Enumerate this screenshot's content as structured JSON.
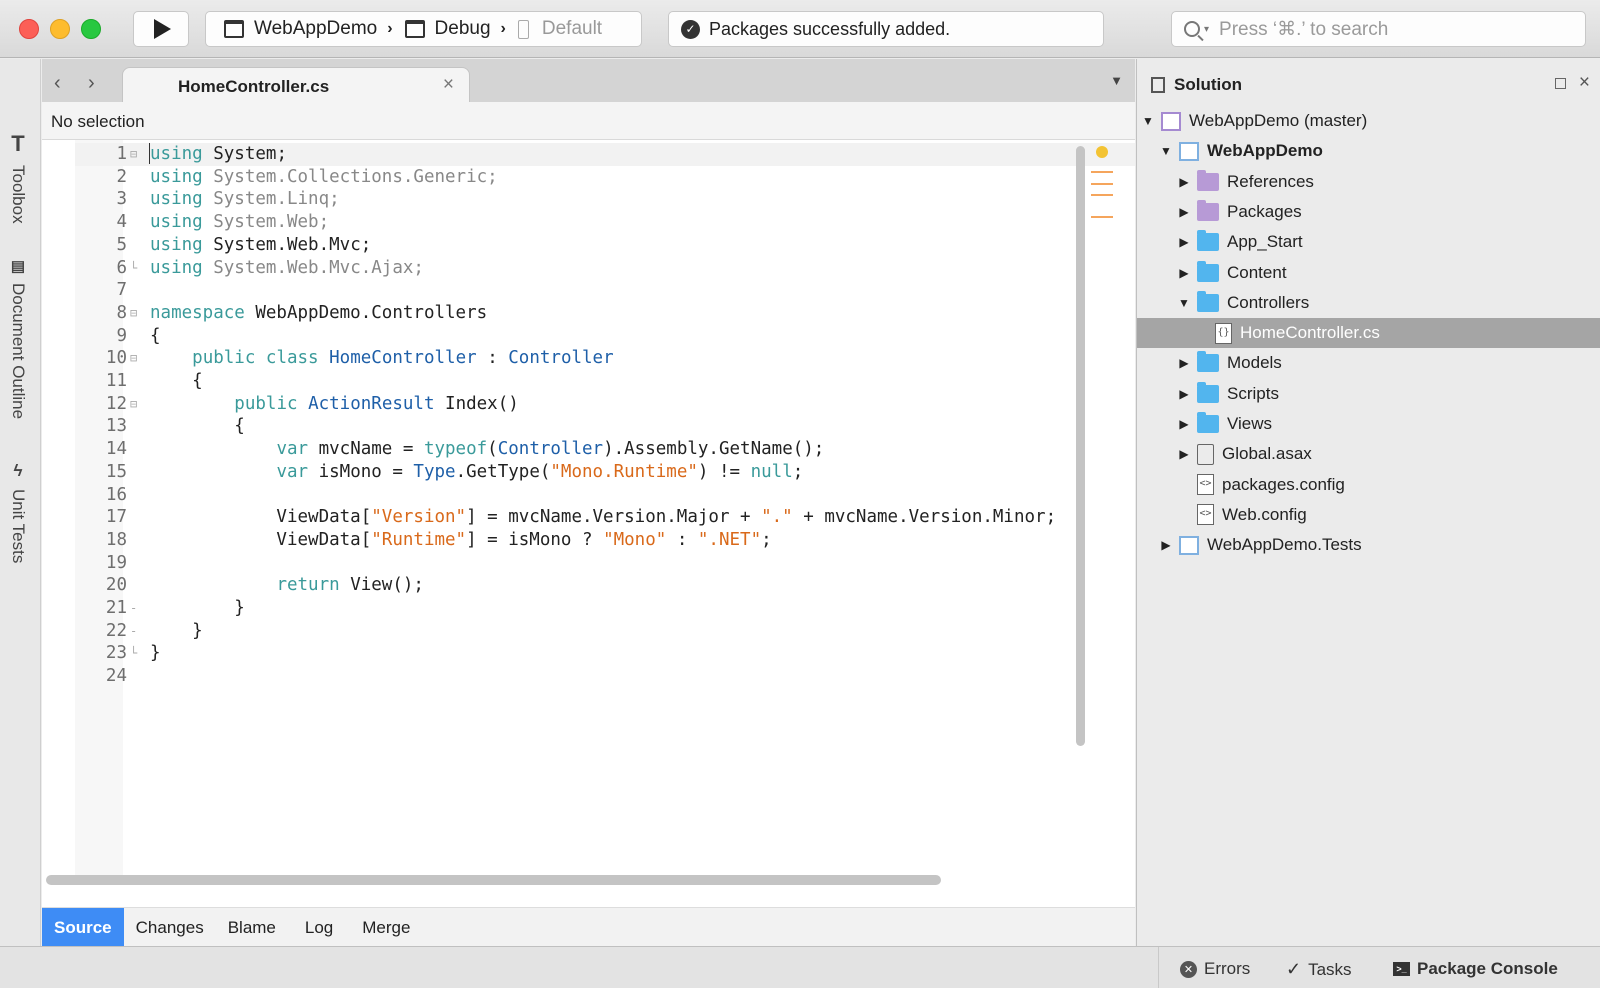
{
  "toolbar": {
    "project": "WebAppDemo",
    "configuration": "Debug",
    "device": "Default",
    "status_message": "Packages successfully added.",
    "search_placeholder": "Press ‘⌘.’ to search"
  },
  "side_pads": [
    "Toolbox",
    "Document Outline",
    "Unit Tests"
  ],
  "editor": {
    "tab_title": "HomeController.cs",
    "breadcrumb": "No selection",
    "lines": [
      {
        "n": "1",
        "fold": "⊟",
        "html": "<span class=\"kw\">using</span> System;"
      },
      {
        "n": "2",
        "fold": "",
        "html": "<span class=\"kw\">using</span> <span class=\"dim\">System.Collections.Generic;</span>"
      },
      {
        "n": "3",
        "fold": "",
        "html": "<span class=\"kw\">using</span> <span class=\"dim\">System.Linq;</span>"
      },
      {
        "n": "4",
        "fold": "",
        "html": "<span class=\"kw\">using</span> <span class=\"dim\">System.Web;</span>"
      },
      {
        "n": "5",
        "fold": "",
        "html": "<span class=\"kw\">using</span> System.Web.Mvc;"
      },
      {
        "n": "6",
        "fold": "└",
        "html": "<span class=\"kw\">using</span> <span class=\"dim\">System.Web.Mvc.Ajax;</span>"
      },
      {
        "n": "7",
        "fold": "",
        "html": ""
      },
      {
        "n": "8",
        "fold": "⊟",
        "html": "<span class=\"kw\">namespace</span> WebAppDemo.Controllers"
      },
      {
        "n": "9",
        "fold": "",
        "html": "{"
      },
      {
        "n": "10",
        "fold": "⊟",
        "html": "    <span class=\"kw\">public class</span> <span class=\"ty\">HomeController</span> : <span class=\"ty\">Controller</span>"
      },
      {
        "n": "11",
        "fold": "",
        "html": "    {"
      },
      {
        "n": "12",
        "fold": "⊟",
        "html": "        <span class=\"kw\">public</span> <span class=\"ty\">ActionResult</span> Index()"
      },
      {
        "n": "13",
        "fold": "",
        "html": "        {"
      },
      {
        "n": "14",
        "fold": "",
        "html": "            <span class=\"kw\">var</span> mvcName = <span class=\"kw\">typeof</span>(<span class=\"ty\">Controller</span>).Assembly.GetName();"
      },
      {
        "n": "15",
        "fold": "",
        "html": "            <span class=\"kw\">var</span> isMono = <span class=\"ty\">Type</span>.GetType(<span class=\"st\">\"Mono.Runtime\"</span>) != <span class=\"kw\">null</span>;"
      },
      {
        "n": "16",
        "fold": "",
        "html": ""
      },
      {
        "n": "17",
        "fold": "",
        "html": "            ViewData[<span class=\"st\">\"Version\"</span>] = mvcName.Version.Major + <span class=\"st\">\".\"</span> + mvcName.Version.Minor;"
      },
      {
        "n": "18",
        "fold": "",
        "html": "            ViewData[<span class=\"st\">\"Runtime\"</span>] = isMono ? <span class=\"st\">\"Mono\"</span> : <span class=\"st\">\".NET\"</span>;"
      },
      {
        "n": "19",
        "fold": "",
        "html": ""
      },
      {
        "n": "20",
        "fold": "",
        "html": "            <span class=\"kw\">return</span> View();"
      },
      {
        "n": "21",
        "fold": "-",
        "html": "        }"
      },
      {
        "n": "22",
        "fold": "-",
        "html": "    }"
      },
      {
        "n": "23",
        "fold": "└",
        "html": "}"
      },
      {
        "n": "24",
        "fold": "",
        "html": ""
      }
    ]
  },
  "version_tabs": [
    "Source",
    "Changes",
    "Blame",
    "Log",
    "Merge"
  ],
  "solution": {
    "title": "Solution",
    "items": [
      {
        "label": "WebAppDemo (master)",
        "indent": 0,
        "exp": "▼",
        "icon": "solution",
        "bold": false,
        "selected": false
      },
      {
        "label": "WebAppDemo",
        "indent": 1,
        "exp": "▼",
        "icon": "project",
        "bold": true,
        "selected": false
      },
      {
        "label": "References",
        "indent": 2,
        "exp": "▶",
        "icon": "folder-purple",
        "bold": false,
        "selected": false
      },
      {
        "label": "Packages",
        "indent": 2,
        "exp": "▶",
        "icon": "folder-purple",
        "bold": false,
        "selected": false
      },
      {
        "label": "App_Start",
        "indent": 2,
        "exp": "▶",
        "icon": "folder",
        "bold": false,
        "selected": false
      },
      {
        "label": "Content",
        "indent": 2,
        "exp": "▶",
        "icon": "folder",
        "bold": false,
        "selected": false
      },
      {
        "label": "Controllers",
        "indent": 2,
        "exp": "▼",
        "icon": "folder",
        "bold": false,
        "selected": false
      },
      {
        "label": "HomeController.cs",
        "indent": 3,
        "exp": "",
        "icon": "file",
        "bold": false,
        "selected": true
      },
      {
        "label": "Models",
        "indent": 2,
        "exp": "▶",
        "icon": "folder",
        "bold": false,
        "selected": false
      },
      {
        "label": "Scripts",
        "indent": 2,
        "exp": "▶",
        "icon": "folder",
        "bold": false,
        "selected": false
      },
      {
        "label": "Views",
        "indent": 2,
        "exp": "▶",
        "icon": "folder",
        "bold": false,
        "selected": false
      },
      {
        "label": "Global.asax",
        "indent": 2,
        "exp": "▶",
        "icon": "gear",
        "bold": false,
        "selected": false
      },
      {
        "label": "packages.config",
        "indent": 2,
        "exp": "",
        "icon": "file",
        "bold": false,
        "selected": false
      },
      {
        "label": "Web.config",
        "indent": 2,
        "exp": "",
        "icon": "file",
        "bold": false,
        "selected": false
      },
      {
        "label": "WebAppDemo.Tests",
        "indent": 1,
        "exp": "▶",
        "icon": "project",
        "bold": false,
        "selected": false
      }
    ]
  },
  "statusbar": {
    "errors": "Errors",
    "tasks": "Tasks",
    "console": "Package Console"
  },
  "colors": {
    "keyword": "#3a9a9a",
    "type": "#1e5fa8",
    "string": "#d9691a",
    "active_tab": "#3e8cf5",
    "folder": "#52b5ee"
  }
}
